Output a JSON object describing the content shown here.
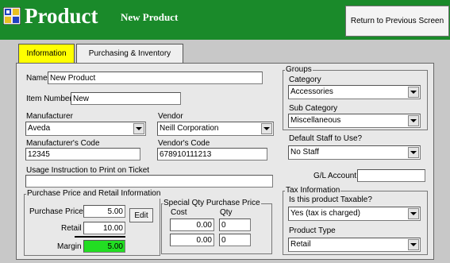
{
  "header": {
    "title": "Product",
    "subtitle": "New Product",
    "return_label": "Return to Previous Screen"
  },
  "tabs": [
    "Information",
    "Purchasing & Inventory"
  ],
  "form": {
    "name_label": "Name",
    "name_value": "New Product",
    "item_number_label": "Item Number",
    "item_number_value": "New",
    "manufacturer_label": "Manufacturer",
    "manufacturer_value": "Aveda",
    "vendor_label": "Vendor",
    "vendor_value": "Neill Corporation",
    "manufacturer_code_label": "Manufacturer's Code",
    "manufacturer_code_value": "12345",
    "vendor_code_label": "Vendor's Code",
    "vendor_code_value": "678910111213",
    "usage_label": "Usage Instruction to Print on Ticket",
    "usage_value": ""
  },
  "pricing": {
    "group_label": "Purchase Price and Retail Information",
    "purchase_price_label": "Purchase Price",
    "purchase_price_value": "5.00",
    "edit_label": "Edit",
    "retail_label": "Retail",
    "retail_value": "10.00",
    "margin_label": "Margin",
    "margin_value": "5.00",
    "margin_color": "#22dd22"
  },
  "special_qty": {
    "group_label": "Special Qty Purchase Price",
    "cost_label": "Cost",
    "qty_label": "Qty",
    "rows": [
      {
        "cost": "0.00",
        "qty": "0"
      },
      {
        "cost": "0.00",
        "qty": "0"
      }
    ]
  },
  "groups": {
    "group_label": "Groups",
    "category_label": "Category",
    "category_value": "Accessories",
    "subcategory_label": "Sub Category",
    "subcategory_value": "Miscellaneous"
  },
  "staff": {
    "label": "Default Staff to Use?",
    "value": "No Staff"
  },
  "gl": {
    "label": "G/L Account:",
    "value": ""
  },
  "tax": {
    "group_label": "Tax Information",
    "taxable_label": "Is this product Taxable?",
    "taxable_value": "Yes (tax is charged)",
    "product_type_label": "Product Type",
    "product_type_value": "Retail"
  },
  "colors": {
    "header_green": "#1a8a2a",
    "active_tab": "#ffff00"
  },
  "icons": [
    "product-logo-icon",
    "dropdown-arrow-icon"
  ]
}
